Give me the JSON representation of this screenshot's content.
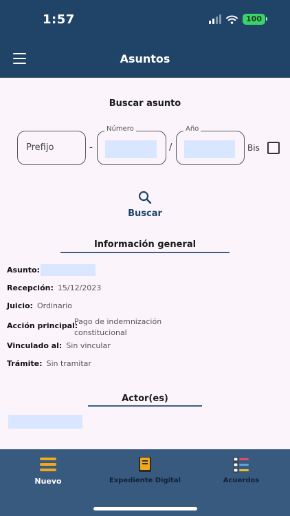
{
  "status_bar": {
    "time": "1:57",
    "battery": "100"
  },
  "header": {
    "title": "Asuntos"
  },
  "search": {
    "title": "Buscar asunto",
    "prefix_placeholder": "Prefijo",
    "number_label": "Número",
    "year_label": "Año",
    "dash": "-",
    "slash": "/",
    "bis_label": "Bis",
    "button_label": "Buscar"
  },
  "general": {
    "title": "Información general",
    "asunto_label": "Asunto:",
    "recepcion_label": "Recepción:",
    "recepcion_value": "15/12/2023",
    "juicio_label": "Juicio:",
    "juicio_value": "Ordinario",
    "accion_label": "Acción principal:",
    "accion_value_line1": "Pago de indemnización",
    "accion_value_line2": "constitucional",
    "vinculado_label": "Vinculado al:",
    "vinculado_value": "Sin vincular",
    "tramite_label": "Trámite:",
    "tramite_value": "Sin tramitar"
  },
  "actors": {
    "title": "Actor(es)"
  },
  "tabbar": {
    "tabs": [
      {
        "label": "Nuevo",
        "icon": "menu-lines-icon",
        "active": true
      },
      {
        "label": "Expediente Digital",
        "icon": "book-icon",
        "active": false
      },
      {
        "label": "Acuerdos",
        "icon": "list-numbered-icon",
        "active": false
      }
    ]
  },
  "colors": {
    "header": "#1f4467",
    "tabbar": "#375a7e",
    "accent": "#f0a81e",
    "field_fill": "#d9e6ff"
  }
}
